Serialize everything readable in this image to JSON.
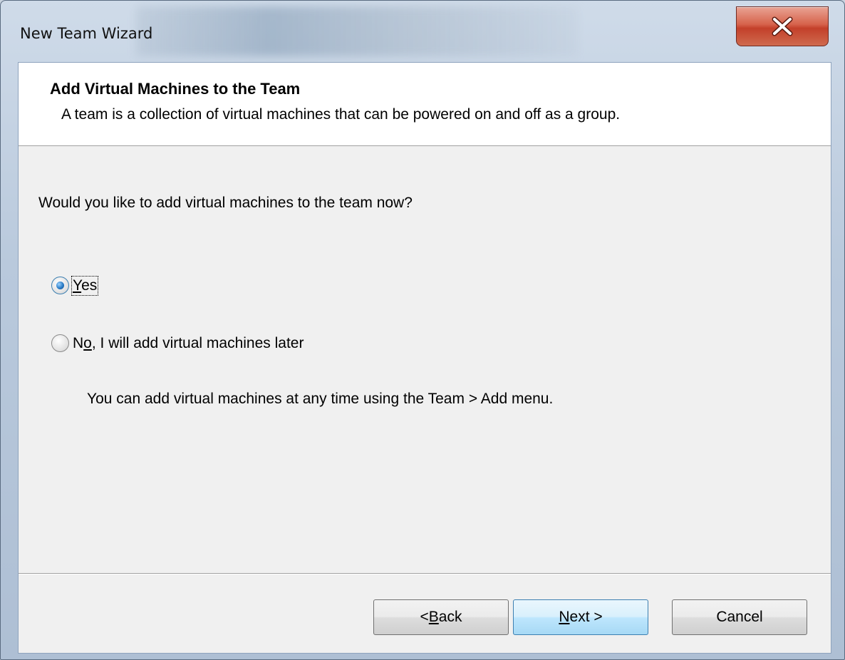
{
  "window": {
    "title": "New Team Wizard",
    "close_icon": "close-x-icon"
  },
  "header": {
    "title": "Add Virtual Machines to the Team",
    "description": "A team is a collection of virtual machines that can be powered on and off as a group."
  },
  "main": {
    "question": "Would you like to add virtual machines to the team now?",
    "options": [
      {
        "label_pre": "",
        "label_mnemonic": "Y",
        "label_post": "es",
        "selected": true
      },
      {
        "label_pre": "N",
        "label_mnemonic": "o",
        "label_post": ", I will add virtual machines later",
        "selected": false
      }
    ],
    "hint": "You can add virtual machines at any time using the Team > Add menu."
  },
  "buttons": {
    "back": {
      "pre": "< ",
      "mnemonic": "B",
      "post": "ack"
    },
    "next": {
      "pre": "",
      "mnemonic": "N",
      "post": "ext >"
    },
    "cancel": "Cancel"
  },
  "colors": {
    "selected_radio": "#2a7bc6",
    "close_button": "#c3402a",
    "default_button": "#bee6fd"
  }
}
